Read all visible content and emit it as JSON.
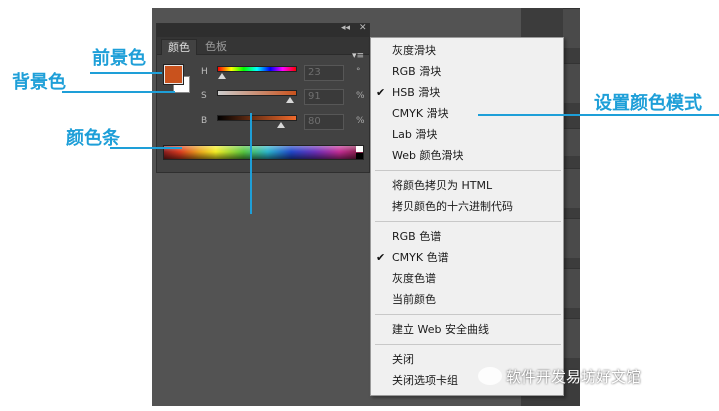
{
  "panel": {
    "tabs": [
      "颜色",
      "色板"
    ],
    "collapse_icon": "◂◂",
    "close_icon": "✕",
    "menu_icon": "▾≡",
    "foreground_color": "#c9521d",
    "background_color": "#ffffff",
    "sliders": [
      {
        "label": "H",
        "value": "23",
        "unit": "°",
        "level": 0.06
      },
      {
        "label": "S",
        "value": "91",
        "unit": "%",
        "level": 0.91
      },
      {
        "label": "B",
        "value": "80",
        "unit": "%",
        "level": 0.8
      }
    ]
  },
  "menu": {
    "groups": [
      [
        {
          "label": "灰度滑块",
          "checked": false
        },
        {
          "label": "RGB 滑块",
          "checked": false
        },
        {
          "label": "HSB 滑块",
          "checked": true
        },
        {
          "label": "CMYK 滑块",
          "checked": false
        },
        {
          "label": "Lab 滑块",
          "checked": false
        },
        {
          "label": "Web 颜色滑块",
          "checked": false
        }
      ],
      [
        {
          "label": "将颜色拷贝为 HTML",
          "checked": false
        },
        {
          "label": "拷贝颜色的十六进制代码",
          "checked": false
        }
      ],
      [
        {
          "label": "RGB 色谱",
          "checked": false
        },
        {
          "label": "CMYK 色谱",
          "checked": true
        },
        {
          "label": "灰度色谱",
          "checked": false
        },
        {
          "label": "当前颜色",
          "checked": false
        }
      ],
      [
        {
          "label": "建立 Web 安全曲线",
          "checked": false
        }
      ],
      [
        {
          "label": "关闭",
          "checked": false
        },
        {
          "label": "关闭选项卡组",
          "checked": false
        }
      ]
    ]
  },
  "annotations": {
    "foreground": "前景色",
    "background": "背景色",
    "color_bar": "颜色条",
    "set_mode": "设置颜色模式"
  },
  "watermark": "软件开发易坊好文馆",
  "colors": {
    "accent": "#1e9fd8",
    "workspace": "#535353",
    "panel": "#424242"
  }
}
